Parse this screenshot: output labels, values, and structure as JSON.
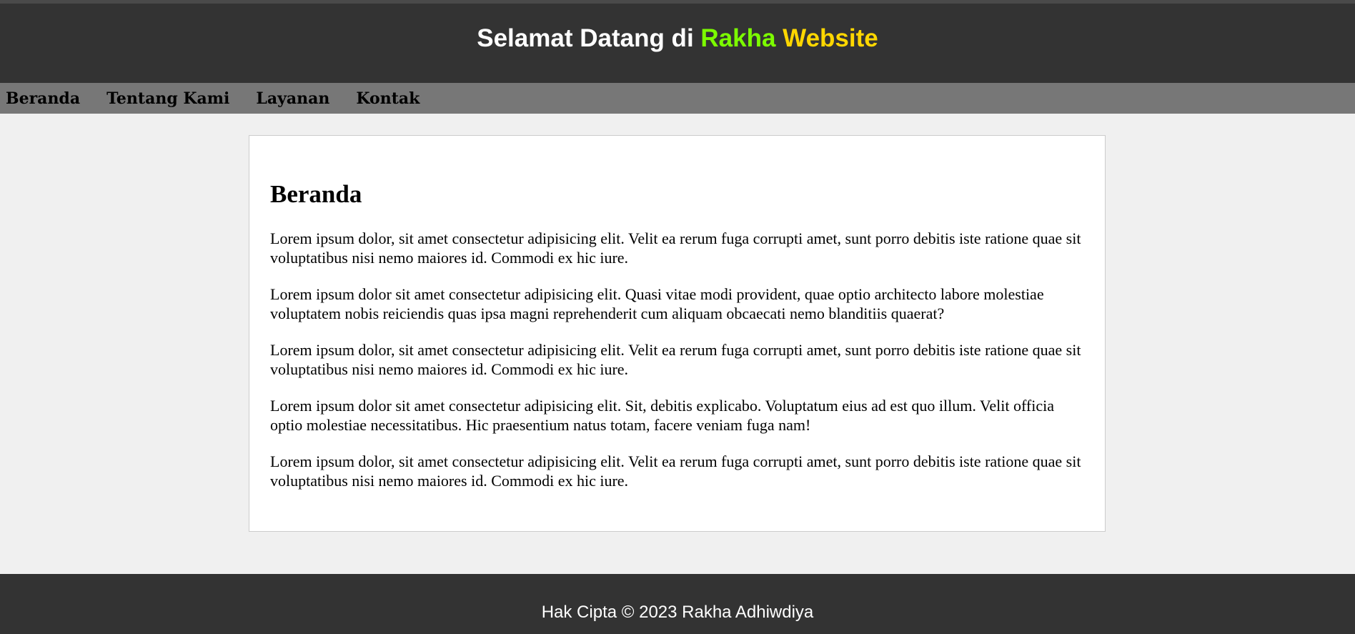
{
  "header": {
    "title_prefix": "Selamat Datang di ",
    "title_accent_1": "Rakha",
    "title_accent_2": " Website",
    "colors": {
      "background": "#333333",
      "accent_1": "#7cfc00",
      "accent_2": "#ffd700"
    }
  },
  "nav": {
    "items": [
      {
        "label": "Beranda"
      },
      {
        "label": "Tentang Kami"
      },
      {
        "label": "Layanan"
      },
      {
        "label": "Kontak"
      }
    ],
    "background": "#777777"
  },
  "main": {
    "heading": "Beranda",
    "paragraphs": [
      "Lorem ipsum dolor, sit amet consectetur adipisicing elit. Velit ea rerum fuga corrupti amet, sunt porro debitis iste ratione quae sit voluptatibus nisi nemo maiores id. Commodi ex hic iure.",
      "Lorem ipsum dolor sit amet consectetur adipisicing elit. Quasi vitae modi provident, quae optio architecto labore molestiae voluptatem nobis reiciendis quas ipsa magni reprehenderit cum aliquam obcaecati nemo blanditiis quaerat?",
      "Lorem ipsum dolor, sit amet consectetur adipisicing elit. Velit ea rerum fuga corrupti amet, sunt porro debitis iste ratione quae sit voluptatibus nisi nemo maiores id. Commodi ex hic iure.",
      "Lorem ipsum dolor sit amet consectetur adipisicing elit. Sit, debitis explicabo. Voluptatum eius ad est quo illum. Velit officia optio molestiae necessitatibus. Hic praesentium natus totam, facere veniam fuga nam!",
      "Lorem ipsum dolor, sit amet consectetur adipisicing elit. Velit ea rerum fuga corrupti amet, sunt porro debitis iste ratione quae sit voluptatibus nisi nemo maiores id. Commodi ex hic iure."
    ]
  },
  "footer": {
    "text": "Hak Cipta © 2023 Rakha Adhiwdiya"
  }
}
